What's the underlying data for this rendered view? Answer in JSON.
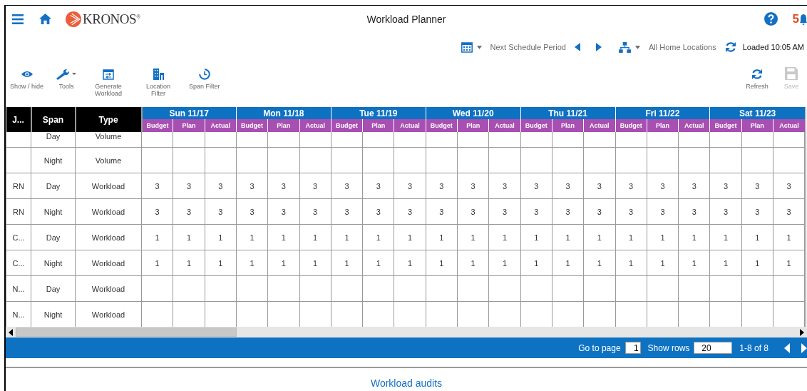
{
  "header": {
    "logo": "KRONOS$^{®}$",
    "title": "Workload Planner",
    "notification_count": "5"
  },
  "period_bar": {
    "period": "Next Schedule Period",
    "locations": "All Home Locations",
    "loaded": "Loaded 10:05 AM"
  },
  "toolbar_left": [
    {
      "kind": "eye",
      "label": "Show / hide",
      "disabled": false
    },
    {
      "kind": "wrench",
      "label": "Tools",
      "disabled": false
    },
    {
      "kind": "generate",
      "label": "Generate Workload",
      "disabled": false
    },
    {
      "kind": "building",
      "label": "Location Filter",
      "disabled": false
    },
    {
      "kind": "clock",
      "label": "Span Filter",
      "disabled": false
    }
  ],
  "toolbar_right": [
    {
      "kind": "refresh",
      "label": "Refresh",
      "disabled": false
    },
    {
      "kind": "save",
      "label": "Save",
      "disabled": true
    }
  ],
  "table": {
    "columns": [
      "J...",
      "Span",
      "Type"
    ],
    "days": [
      {
        "label": "Sun 11/17",
        "subcolumns": [
          "Budget",
          "Plan",
          "Actual"
        ]
      },
      {
        "label": "Mon 11/18",
        "subcolumns": [
          "Budget",
          "Plan",
          "Actual"
        ]
      },
      {
        "label": "Tue 11/19",
        "subcolumns": [
          "Budget",
          "Plan",
          "Actual"
        ]
      },
      {
        "label": "Wed 11/20",
        "subcolumns": [
          "Budget",
          "Plan",
          "Actual"
        ]
      },
      {
        "label": "Thu 11/21",
        "subcolumns": [
          "Budget",
          "Plan",
          "Actual"
        ]
      },
      {
        "label": "Fri 11/22",
        "subcolumns": [
          "Budget",
          "Plan",
          "Actual"
        ]
      },
      {
        "label": "Sat 11/23",
        "subcolumns": [
          "Budget",
          "Plan",
          "Actual"
        ]
      }
    ],
    "rows": [
      {
        "span": "Day",
        "type": "Volume"
      },
      {
        "span": "Night",
        "type": "Volume"
      },
      {
        "job": "RN",
        "span": "Day",
        "type": "Workload",
        "values": [
          "3",
          "3",
          "3",
          "3",
          "3",
          "3",
          "3",
          "3",
          "3",
          "3",
          "3",
          "3",
          "3",
          "3",
          "3",
          "3",
          "3",
          "3",
          "3",
          "3",
          "3"
        ]
      },
      {
        "job": "RN",
        "span": "Night",
        "type": "Workload",
        "values": [
          "3",
          "3",
          "3",
          "3",
          "3",
          "3",
          "3",
          "3",
          "3",
          "3",
          "3",
          "3",
          "3",
          "3",
          "3",
          "3",
          "3",
          "3",
          "3",
          "3",
          "3"
        ]
      },
      {
        "job": "C...",
        "span": "Day",
        "type": "Workload",
        "values": [
          "1",
          "1",
          "1",
          "1",
          "1",
          "1",
          "1",
          "1",
          "1",
          "1",
          "1",
          "1",
          "1",
          "1",
          "1",
          "1",
          "1",
          "1",
          "1",
          "1",
          "1"
        ]
      },
      {
        "job": "C...",
        "span": "Night",
        "type": "Workload",
        "values": [
          "1",
          "1",
          "1",
          "1",
          "1",
          "1",
          "1",
          "1",
          "1",
          "1",
          "1",
          "1",
          "1",
          "1",
          "1",
          "1",
          "1",
          "1",
          "1",
          "1",
          "1"
        ]
      },
      {
        "job": "N...",
        "span": "Day",
        "type": "Workload"
      },
      {
        "job": "N...",
        "span": "Night",
        "type": "Workload"
      }
    ]
  },
  "pager": {
    "go_to_page": "Go to page",
    "page": "1",
    "show_rows": "Show rows",
    "rows": "20",
    "range": "1-8 of 8"
  },
  "footer_link": "Workload audits"
}
